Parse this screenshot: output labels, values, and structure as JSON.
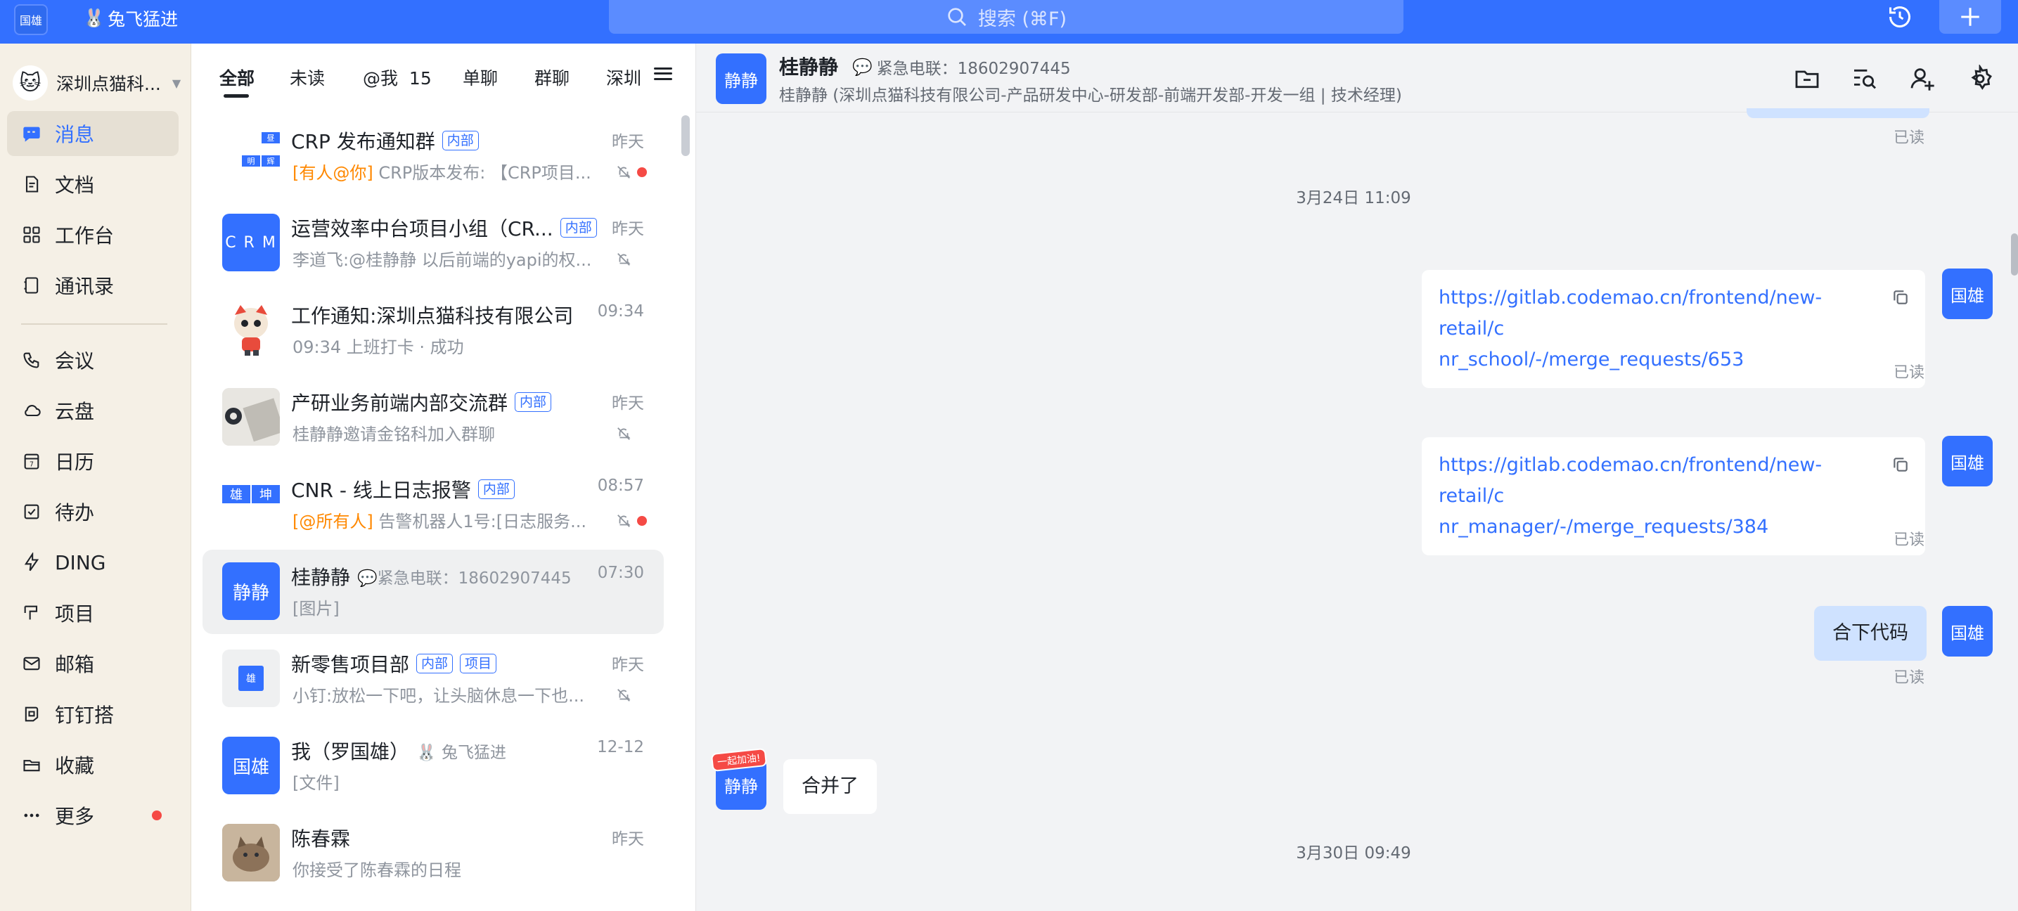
{
  "topbar": {
    "avatar_label": "国雄",
    "status_emoji": "🐰",
    "status_text": "兔飞猛进",
    "search_placeholder": "搜索 (⌘F)"
  },
  "sidebar": {
    "org_name": "深圳点猫科...",
    "items": [
      {
        "label": "消息",
        "icon": "message-icon"
      },
      {
        "label": "文档",
        "icon": "document-icon"
      },
      {
        "label": "工作台",
        "icon": "workbench-icon"
      },
      {
        "label": "通讯录",
        "icon": "contacts-icon"
      },
      {
        "label": "会议",
        "icon": "meeting-icon"
      },
      {
        "label": "云盘",
        "icon": "cloud-icon"
      },
      {
        "label": "日历",
        "icon": "calendar-icon"
      },
      {
        "label": "待办",
        "icon": "todo-icon"
      },
      {
        "label": "DING",
        "icon": "ding-icon"
      },
      {
        "label": "项目",
        "icon": "project-icon"
      },
      {
        "label": "邮箱",
        "icon": "mail-icon"
      },
      {
        "label": "钉钉搭",
        "icon": "builder-icon"
      },
      {
        "label": "收藏",
        "icon": "favorites-icon"
      },
      {
        "label": "更多",
        "icon": "more-icon"
      }
    ],
    "calendar_day": "7"
  },
  "tabs": {
    "all": "全部",
    "unread": "未读",
    "mention": "@我",
    "mention_count": "15",
    "single": "单聊",
    "group": "群聊",
    "shenzhen": "深圳"
  },
  "conversations": [
    {
      "title": "CRP 发布通知群",
      "badges": [
        "内部"
      ],
      "time": "昨天",
      "mention": "[有人@你]",
      "preview": "CRP版本发布: 【CRP项目...",
      "muted": true,
      "unread_dot": true,
      "mosaic": [
        "昼",
        "明",
        "辉"
      ]
    },
    {
      "title": "运营效率中台项目小组（CR...",
      "badges": [
        "内部"
      ],
      "time": "昨天",
      "preview": "李道飞:@桂静静  以后前端的yapi的权...",
      "muted": true,
      "avatar_text": "C R M"
    },
    {
      "title": "工作通知:深圳点猫科技有限公司",
      "time": "09:34",
      "preview": "09:34 上班打卡 · 成功"
    },
    {
      "title": "产研业务前端内部交流群",
      "badges": [
        "内部"
      ],
      "time": "昨天",
      "preview": "桂静静邀请金铭科加入群聊",
      "muted": true
    },
    {
      "title": "CNR - 线上日志报警",
      "badges": [
        "内部"
      ],
      "time": "08:57",
      "mention": "[@所有人]",
      "preview": "告警机器人1号:[日志服务...",
      "muted": true,
      "unread_dot": true,
      "mosaic": [
        "雄",
        "坤"
      ]
    },
    {
      "title": "桂静静",
      "subtitle": "紧急电联：18602907445",
      "time": "07:30",
      "preview": "[图片]",
      "avatar_text": "静静"
    },
    {
      "title": "新零售项目部",
      "badges": [
        "内部",
        "项目"
      ],
      "time": "昨天",
      "preview": "小钉:放松一下吧，让头脑休息一下也...",
      "muted": true,
      "avatar_text": "雄"
    },
    {
      "title": "我（罗国雄）",
      "subtitle": "🐰 兔飞猛进",
      "time": "12-12",
      "preview": "[文件]",
      "avatar_text": "国雄"
    },
    {
      "title": "陈春霖",
      "time": "昨天",
      "preview": "你接受了陈春霖的日程"
    }
  ],
  "chat": {
    "avatar": "静静",
    "name": "桂静静",
    "status": "紧急电联：18602907445",
    "description": "桂静静 (深圳点猫科技有限公司-产品研发中心-研发部-前端开发部-开发一组 | 技术经理)",
    "read_label": "已读",
    "my_avatar": "国雄",
    "ribbon": "一起加油!",
    "messages": [
      {
        "type": "time",
        "text": "3月24日 11:09"
      },
      {
        "type": "link",
        "line1": "https://gitlab.codemao.cn/frontend/new-retail/c",
        "line2": "nr_school/-/merge_requests/653"
      },
      {
        "type": "link",
        "line1": "https://gitlab.codemao.cn/frontend/new-retail/c",
        "line2": "nr_manager/-/merge_requests/384"
      },
      {
        "type": "mine",
        "text": "合下代码"
      },
      {
        "type": "theirs",
        "text": "合并了"
      },
      {
        "type": "time",
        "text": "3月30日 09:49"
      }
    ]
  },
  "colors": {
    "accent": "#3370ff",
    "nav_bg": "#f5f0e6",
    "unread_red": "#f54a45",
    "mention_orange": "#ff8800"
  }
}
